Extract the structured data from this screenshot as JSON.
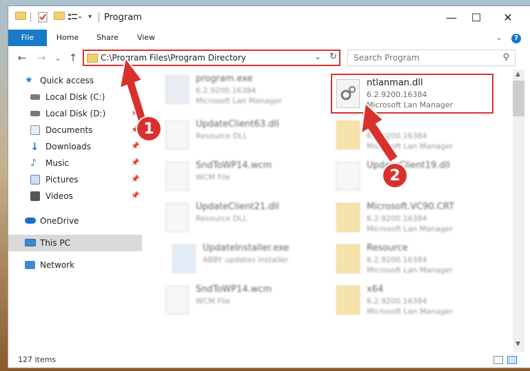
{
  "window": {
    "title": "Program",
    "controls": {
      "minimize": "—",
      "maximize": "☐",
      "close": "✕"
    }
  },
  "ribbon": {
    "tabs": [
      "File",
      "Home",
      "Share",
      "View"
    ],
    "expand_icon": "⌄",
    "help_icon": "?"
  },
  "nav": {
    "back": "←",
    "forward": "→",
    "recent": "⌄",
    "up": "↑"
  },
  "address": {
    "path": "C:\\Program Files\\Program Directory",
    "dropdown": "⌄",
    "refresh": "↻"
  },
  "search": {
    "placeholder": "Search Program",
    "icon": "⚲"
  },
  "sidebar": {
    "items": [
      {
        "label": "Quick access",
        "icon": "star-icon",
        "color": "#2b78d1",
        "pinned": false
      },
      {
        "label": "Local Disk (C:)",
        "icon": "drive-icon",
        "color": "#7a7a7a",
        "pinned": true
      },
      {
        "label": "Local Disk (D:)",
        "icon": "drive-icon",
        "color": "#7a7a7a",
        "pinned": true
      },
      {
        "label": "Documents",
        "icon": "documents-icon",
        "color": "#6e8fb3",
        "pinned": true
      },
      {
        "label": "Downloads",
        "icon": "download-icon",
        "color": "#2b78d1",
        "pinned": true
      },
      {
        "label": "Music",
        "icon": "music-icon",
        "color": "#2b78d1",
        "pinned": true
      },
      {
        "label": "Pictures",
        "icon": "pictures-icon",
        "color": "#4a86c5",
        "pinned": true
      },
      {
        "label": "Videos",
        "icon": "videos-icon",
        "color": "#555555",
        "pinned": true
      },
      {
        "label": "OneDrive",
        "icon": "cloud-icon",
        "color": "#1b6fc9",
        "pinned": false
      },
      {
        "label": "This PC",
        "icon": "computer-icon",
        "color": "#3a8bd4",
        "pinned": false
      },
      {
        "label": "Network",
        "icon": "network-icon",
        "color": "#3a8bd4",
        "pinned": false
      }
    ],
    "pin_icon": "📌"
  },
  "files": [
    {
      "name": "program.exe",
      "line1": "6.2.9200.16384",
      "line2": "Microsoft Lan Manager",
      "type": "exe",
      "blurred": true
    },
    {
      "name": "ntlanman.dll",
      "line1": "6.2.9200.16384",
      "line2": "Microsoft Lan Manager",
      "type": "dll",
      "blurred": false
    },
    {
      "name": "UpdateClient63.dll",
      "line1": "Resource DLL",
      "line2": "",
      "type": "dll",
      "blurred": true
    },
    {
      "name": "",
      "line1": "6.2.9200.16384",
      "line2": "Microsoft Lan Manager",
      "type": "folder",
      "blurred": true
    },
    {
      "name": "SndToWP14.wcm",
      "line1": "WCM File",
      "line2": "",
      "type": "file",
      "blurred": true
    },
    {
      "name": "UpdateClient19.dll",
      "line1": "",
      "line2": "",
      "type": "dll",
      "blurred": true
    },
    {
      "name": "UpdateClient21.dll",
      "line1": "Resource DLL",
      "line2": "",
      "type": "dll",
      "blurred": true
    },
    {
      "name": "Microsoft.VC90.CRT",
      "line1": "6.2.9200.16384",
      "line2": "Microsoft Lan Manager",
      "type": "folder",
      "blurred": true
    },
    {
      "name": "UpdateInstaller.exe",
      "line1": "ABBY updates installer",
      "line2": "",
      "type": "exe",
      "blurred": true
    },
    {
      "name": "Resource",
      "line1": "6.2.9200.16384",
      "line2": "Microsoft Lan Manager",
      "type": "folder",
      "blurred": true
    },
    {
      "name": "SndToWP14.wcm",
      "line1": "WCM File",
      "line2": "",
      "type": "file",
      "blurred": true
    },
    {
      "name": "x64",
      "line1": "6.2.9200.16384",
      "line2": "Microsoft Lan Manager",
      "type": "folder",
      "blurred": true
    }
  ],
  "status": {
    "count": "127 items"
  },
  "annotations": {
    "badge1": "1",
    "badge2": "2",
    "color": "#d9302e"
  }
}
